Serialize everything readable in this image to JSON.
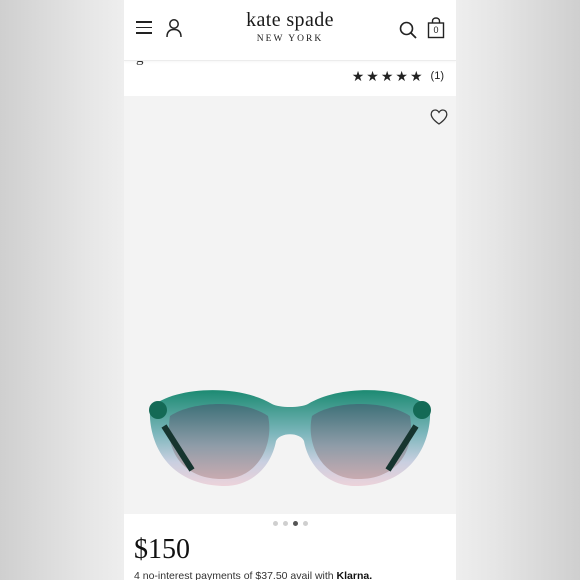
{
  "header": {
    "logo_main": "kate spade",
    "logo_sub": "NEW YORK",
    "bag_count": "0"
  },
  "product": {
    "title_peek": "g",
    "rating_stars": 5,
    "review_count": "(1)",
    "price": "$150",
    "klarna_text": "4 no-interest payments of $37.50 avail with",
    "klarna_brand": "Klarna."
  },
  "carousel": {
    "total": 4,
    "active_index": 2
  },
  "icons": [
    "menu-icon",
    "account-icon",
    "search-icon",
    "bag-icon",
    "heart-icon",
    "star-icon"
  ],
  "colors": {
    "frame_teal": "#1f8a74",
    "frame_pink": "#e6c8d0",
    "text": "#111111"
  }
}
